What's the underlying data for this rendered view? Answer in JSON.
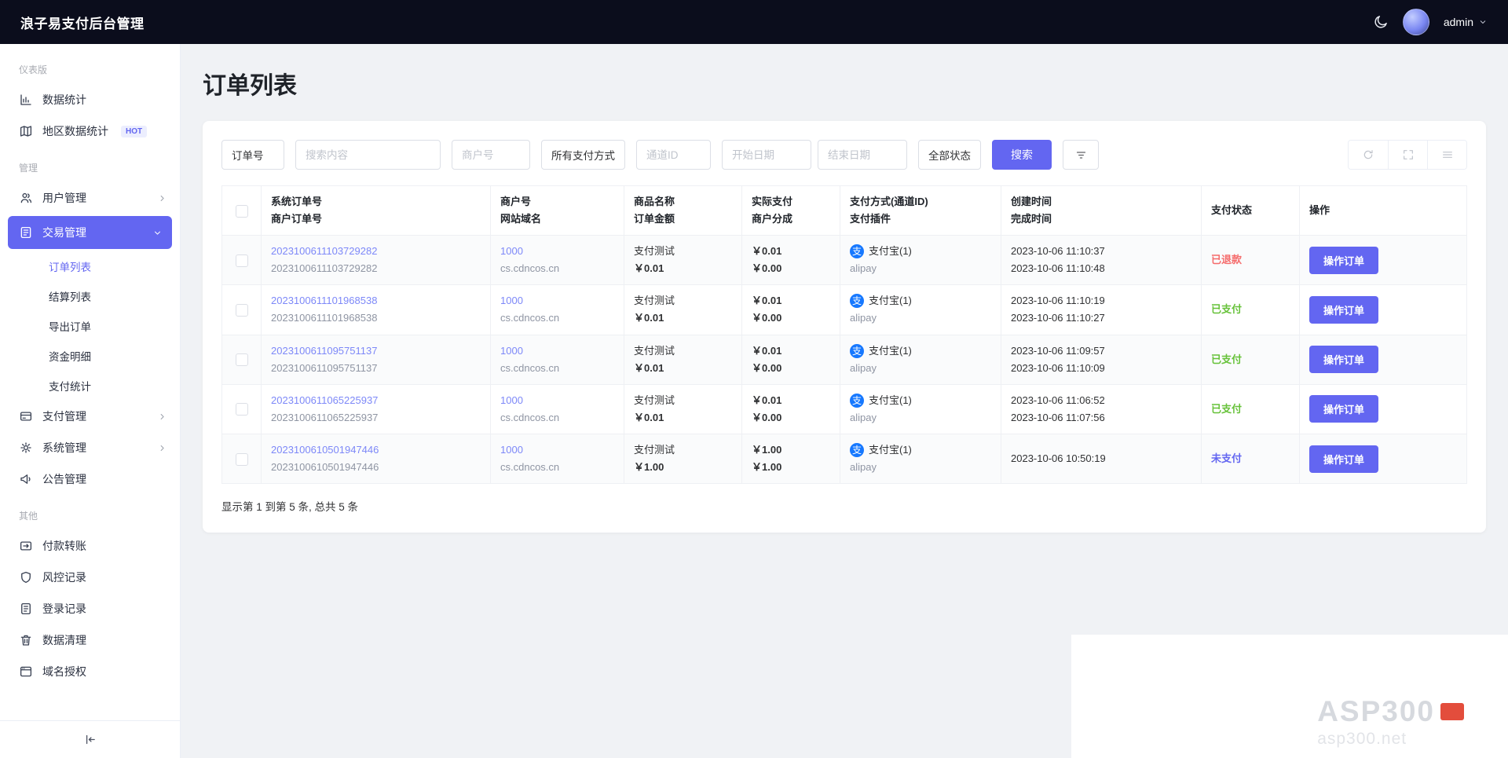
{
  "navbar": {
    "title": "浪子易支付后台管理",
    "username": "admin"
  },
  "page": {
    "title": "订单列表"
  },
  "sidebar": {
    "sections": [
      {
        "label": "仪表版",
        "items": [
          {
            "label": "数据统计",
            "icon": "bar-chart"
          },
          {
            "label": "地区数据统计",
            "icon": "map",
            "badge": "HOT"
          }
        ]
      },
      {
        "label": "管理",
        "items": [
          {
            "label": "用户管理",
            "icon": "users",
            "expandable": true
          },
          {
            "label": "交易管理",
            "icon": "transaction",
            "expandable": true,
            "expanded": true,
            "active": true
          },
          {
            "label": "支付管理",
            "icon": "credit-card",
            "expandable": true
          },
          {
            "label": "系统管理",
            "icon": "gear",
            "expandable": true
          },
          {
            "label": "公告管理",
            "icon": "megaphone"
          }
        ]
      },
      {
        "label": "其他",
        "items": [
          {
            "label": "付款转账",
            "icon": "transfer"
          },
          {
            "label": "风控记录",
            "icon": "shield"
          },
          {
            "label": "登录记录",
            "icon": "log"
          },
          {
            "label": "数据清理",
            "icon": "trash"
          },
          {
            "label": "域名授权",
            "icon": "domain"
          }
        ]
      }
    ],
    "submenu": [
      {
        "label": "订单列表",
        "active": true
      },
      {
        "label": "结算列表"
      },
      {
        "label": "导出订单"
      },
      {
        "label": "资金明细"
      },
      {
        "label": "支付统计"
      }
    ]
  },
  "toolbar": {
    "order_field_select": "订单号",
    "search_placeholder": "搜索内容",
    "merchant_placeholder": "商户号",
    "pay_method_select": "所有支付方式",
    "channel_placeholder": "通道ID",
    "start_date_placeholder": "开始日期",
    "end_date_placeholder": "结束日期",
    "status_select": "全部状态",
    "search_button": "搜索"
  },
  "table": {
    "headers": [
      {
        "line1": "系统订单号",
        "line2": "商户订单号"
      },
      {
        "line1": "商户号",
        "line2": "网站域名"
      },
      {
        "line1": "商品名称",
        "line2": "订单金额"
      },
      {
        "line1": "实际支付",
        "line2": "商户分成"
      },
      {
        "line1": "支付方式(通道ID)",
        "line2": "支付插件"
      },
      {
        "line1": "创建时间",
        "line2": "完成时间"
      },
      {
        "line1": "支付状态",
        "line2": ""
      },
      {
        "line1": "操作",
        "line2": ""
      }
    ],
    "alipay_icon_char": "支",
    "action_label": "操作订单",
    "rows": [
      {
        "sys_order_no": "2023100611103729282",
        "merchant_order_no": "2023100611103729282",
        "merchant_id": "1000",
        "domain": "cs.cdncos.cn",
        "product_name": "支付测试",
        "order_amount": "￥0.01",
        "actual_amount": "￥0.01",
        "merchant_share": "￥0.00",
        "pay_method": "支付宝(1)",
        "pay_plugin": "alipay",
        "created_at": "2023-10-06 11:10:37",
        "completed_at": "2023-10-06 11:10:48",
        "status": "已退款",
        "status_class": "status-refunded"
      },
      {
        "sys_order_no": "2023100611101968538",
        "merchant_order_no": "2023100611101968538",
        "merchant_id": "1000",
        "domain": "cs.cdncos.cn",
        "product_name": "支付测试",
        "order_amount": "￥0.01",
        "actual_amount": "￥0.01",
        "merchant_share": "￥0.00",
        "pay_method": "支付宝(1)",
        "pay_plugin": "alipay",
        "created_at": "2023-10-06 11:10:19",
        "completed_at": "2023-10-06 11:10:27",
        "status": "已支付",
        "status_class": "status-paid"
      },
      {
        "sys_order_no": "2023100611095751137",
        "merchant_order_no": "2023100611095751137",
        "merchant_id": "1000",
        "domain": "cs.cdncos.cn",
        "product_name": "支付测试",
        "order_amount": "￥0.01",
        "actual_amount": "￥0.01",
        "merchant_share": "￥0.00",
        "pay_method": "支付宝(1)",
        "pay_plugin": "alipay",
        "created_at": "2023-10-06 11:09:57",
        "completed_at": "2023-10-06 11:10:09",
        "status": "已支付",
        "status_class": "status-paid"
      },
      {
        "sys_order_no": "2023100611065225937",
        "merchant_order_no": "2023100611065225937",
        "merchant_id": "1000",
        "domain": "cs.cdncos.cn",
        "product_name": "支付测试",
        "order_amount": "￥0.01",
        "actual_amount": "￥0.01",
        "merchant_share": "￥0.00",
        "pay_method": "支付宝(1)",
        "pay_plugin": "alipay",
        "created_at": "2023-10-06 11:06:52",
        "completed_at": "2023-10-06 11:07:56",
        "status": "已支付",
        "status_class": "status-paid"
      },
      {
        "sys_order_no": "2023100610501947446",
        "merchant_order_no": "2023100610501947446",
        "merchant_id": "1000",
        "domain": "cs.cdncos.cn",
        "product_name": "支付测试",
        "order_amount": "￥1.00",
        "actual_amount": "￥1.00",
        "merchant_share": "￥1.00",
        "pay_method": "支付宝(1)",
        "pay_plugin": "alipay",
        "created_at": "2023-10-06 10:50:19",
        "completed_at": "",
        "status": "未支付",
        "status_class": "status-unpaid"
      }
    ],
    "summary": "显示第 1 到第 5 条, 总共 5 条"
  },
  "watermark": {
    "title": "ASP300",
    "domain": "asp300.net"
  },
  "colors": {
    "accent": "#6366f1",
    "navbar_bg": "#0b0d1c",
    "status_refunded": "#f56c6c",
    "status_paid": "#67c23a",
    "status_unpaid": "#6366f1",
    "alipay_blue": "#1678ff",
    "link": "#7d88f8"
  }
}
